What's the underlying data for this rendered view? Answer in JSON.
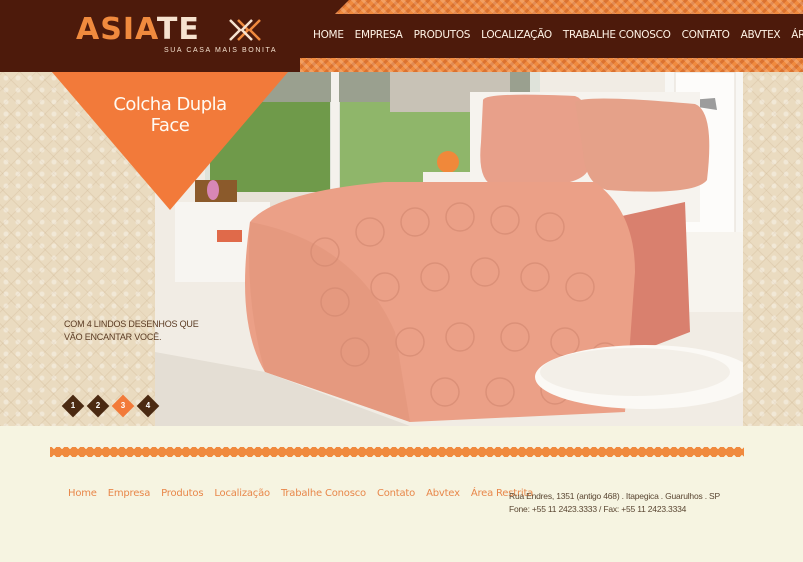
{
  "brand": {
    "name_part1": "ASIA",
    "name_part2": "TE",
    "tagline": "SUA CASA MAIS BONITA",
    "colors": {
      "dark": "#4d1a0b",
      "orange": "#f27a3a",
      "cream": "#f6f4e1"
    }
  },
  "nav": {
    "items": [
      {
        "label": "HOME"
      },
      {
        "label": "EMPRESA"
      },
      {
        "label": "PRODUTOS"
      },
      {
        "label": "LOCALIZAÇÃO"
      },
      {
        "label": "TRABALHE CONOSCO"
      },
      {
        "label": "CONTATO"
      },
      {
        "label": "ABVTEX"
      },
      {
        "label": "ÁREA RESTRITA"
      }
    ]
  },
  "hero": {
    "title": "Colcha Dupla Face",
    "caption": "COM 4 LINDOS DESENHOS QUE VÃO ENCANTAR VOCÊ.",
    "slides": [
      "1",
      "2",
      "3",
      "4"
    ],
    "active_slide": 3
  },
  "footer": {
    "links": [
      "Home",
      "Empresa",
      "Produtos",
      "Localização",
      "Trabalhe Conosco",
      "Contato",
      "Abvtex",
      "Área Restrita"
    ],
    "address_line1": "Rua Endres, 1351 (antigo 468) . Itapegica . Guarulhos . SP",
    "address_line2": "Fone: +55 11 2423.3333 / Fax: +55 11 2423.3334"
  }
}
